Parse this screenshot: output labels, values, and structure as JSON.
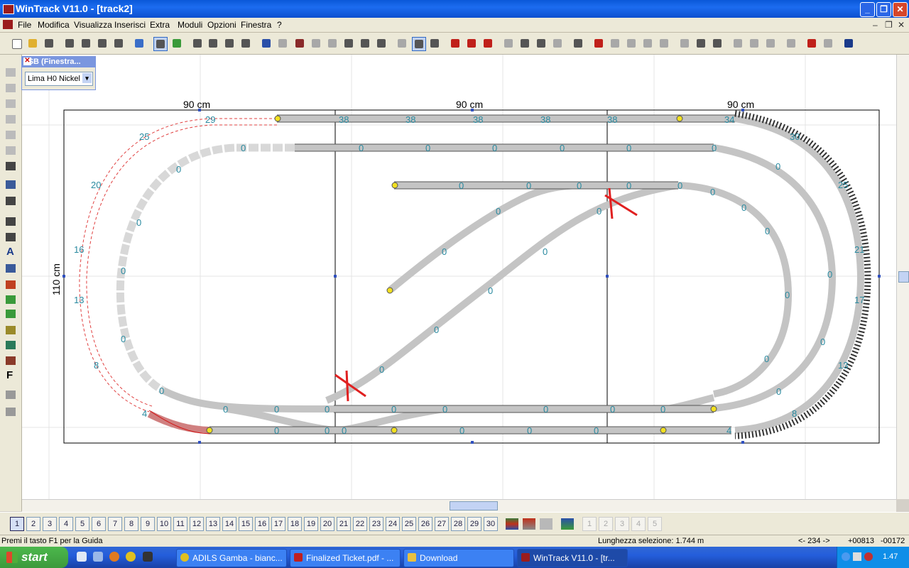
{
  "window": {
    "title": "WinTrack  V11.0 - [track2]",
    "min": "_",
    "max": "❐",
    "close": "✕"
  },
  "menu": [
    "File",
    "Modifica",
    "Visualizza",
    "Inserisci",
    "Extra",
    "Moduli",
    "Opzioni",
    "Finestra",
    "?"
  ],
  "mdi_controls": [
    "‒",
    "❐",
    "✕"
  ],
  "fsb": {
    "caption": "FSB (Finestra...",
    "close": "✕",
    "selected": "Lima H0 Nickel",
    "arrow": "▾"
  },
  "canvas": {
    "dim_top": [
      "90 cm",
      "90 cm",
      "90 cm"
    ],
    "dim_left": "110 cm",
    "outer_track_labels": [
      "29",
      "25",
      "20",
      "16",
      "13",
      "8",
      "4"
    ],
    "top_row_labels": [
      "38",
      "38",
      "38",
      "38",
      "38",
      "38",
      "34"
    ],
    "second_row_labels": [
      "0",
      "0",
      "0",
      "0",
      "0",
      "0",
      "0",
      "0",
      "0",
      "0"
    ],
    "right_labels": [
      "30",
      "25",
      "21",
      "17",
      "13",
      "8",
      "4"
    ],
    "inner_right_labels": [
      "0",
      "0",
      "0",
      "0",
      "0",
      "0",
      "0",
      "0",
      "0"
    ],
    "zero": "0"
  },
  "layers": [
    "1",
    "2",
    "3",
    "4",
    "5",
    "6",
    "7",
    "8",
    "9",
    "10",
    "11",
    "12",
    "13",
    "14",
    "15",
    "16",
    "17",
    "18",
    "19",
    "20",
    "21",
    "22",
    "23",
    "24",
    "25",
    "26",
    "27",
    "28",
    "29",
    "30"
  ],
  "layers_extra": [
    "1",
    "2",
    "3",
    "4",
    "5"
  ],
  "status": {
    "help": "Premi il tasto F1 per la Guida",
    "selection_length": "Lunghezza selezione:  1.744 m",
    "nav": "<- 234 ->",
    "x": "+00813",
    "y": "-00172"
  },
  "taskbar": {
    "start": "start",
    "tasks": [
      "ADILS Gamba - bianc...",
      "Finalized Ticket.pdf - ...",
      "Download",
      "WinTrack  V11.0 - [tr..."
    ],
    "clock": "1.47"
  }
}
